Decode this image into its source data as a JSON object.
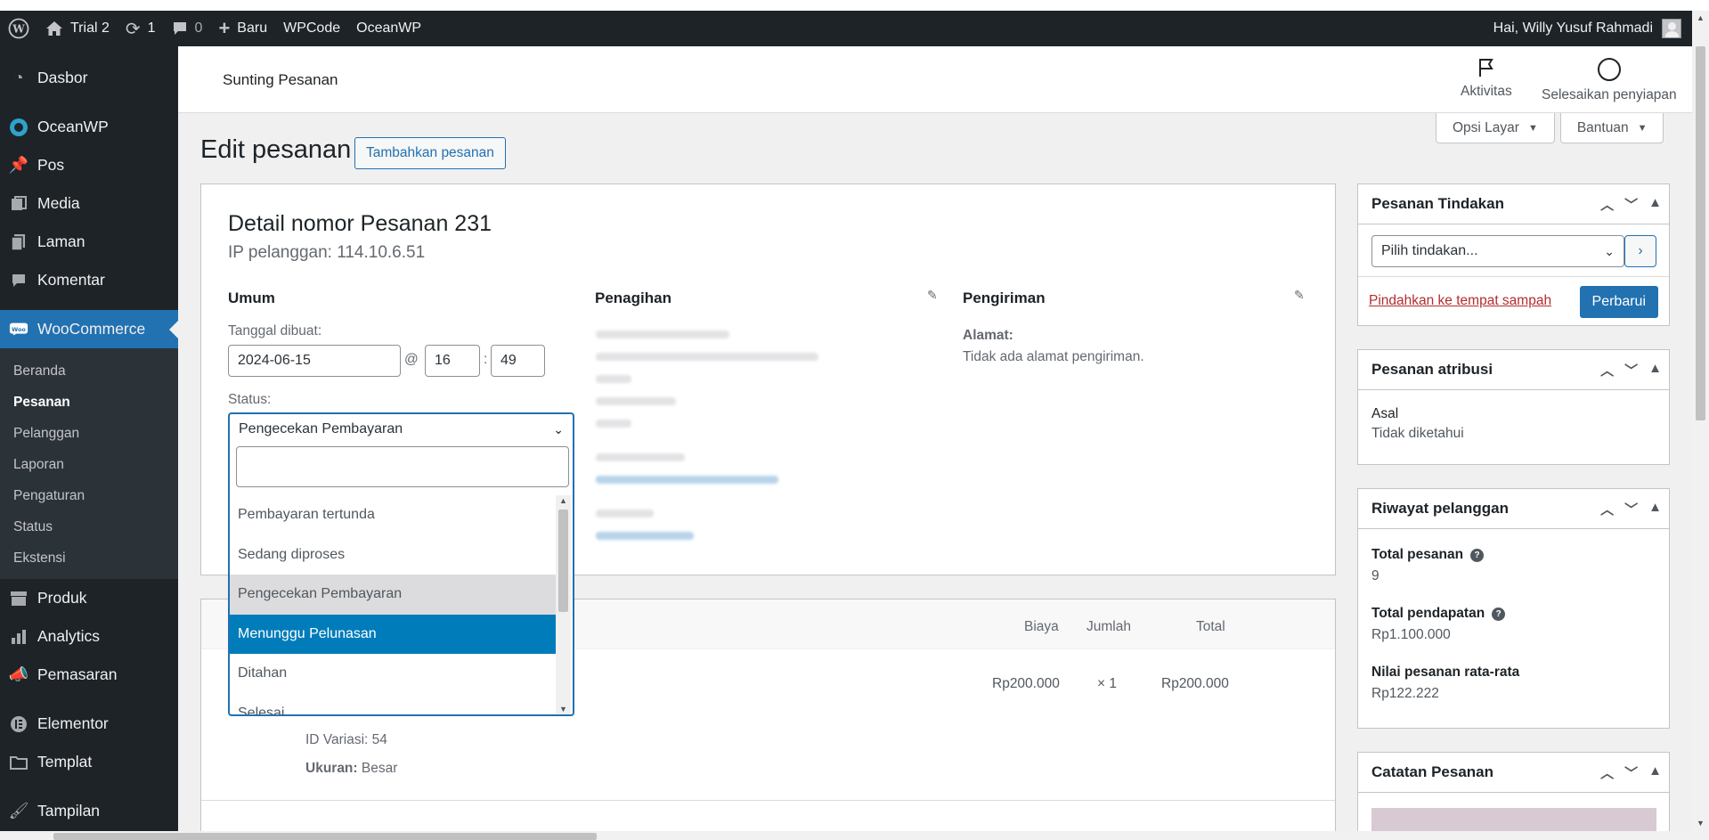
{
  "adminbar": {
    "site_name": "Trial 2",
    "updates_count": "1",
    "comments_count": "0",
    "new_label": "Baru",
    "wpcode_label": "WPCode",
    "oceanwp_label": "OceanWP",
    "greeting": "Hai, Willy Yusuf Rahmadi"
  },
  "sidebar": {
    "items_top": [
      {
        "label": "Dasbor",
        "icon": "dashboard-icon"
      },
      {
        "label": "OceanWP",
        "icon": "oceanwp-icon"
      },
      {
        "label": "Pos",
        "icon": "pin-icon"
      },
      {
        "label": "Media",
        "icon": "media-icon"
      },
      {
        "label": "Laman",
        "icon": "page-icon"
      },
      {
        "label": "Komentar",
        "icon": "comment-icon"
      }
    ],
    "woocommerce_label": "WooCommerce",
    "submenu": [
      "Beranda",
      "Pesanan",
      "Pelanggan",
      "Laporan",
      "Pengaturan",
      "Status",
      "Ekstensi"
    ],
    "items_bottom": [
      {
        "label": "Produk",
        "icon": "archive-icon"
      },
      {
        "label": "Analytics",
        "icon": "bar-chart-icon"
      },
      {
        "label": "Pemasaran",
        "icon": "megaphone-icon"
      },
      {
        "label": "Elementor",
        "icon": "elementor-icon"
      },
      {
        "label": "Templat",
        "icon": "folder-icon"
      },
      {
        "label": "Tampilan",
        "icon": "brush-icon"
      }
    ]
  },
  "header": {
    "title": "Sunting Pesanan",
    "activity_label": "Aktivitas",
    "setup_label": "Selesaikan penyiapan"
  },
  "screen_tabs": {
    "screen_options": "Opsi Layar",
    "help": "Bantuan"
  },
  "page": {
    "title": "Edit pesanan",
    "add_button": "Tambahkan pesanan"
  },
  "order": {
    "heading": "Detail nomor Pesanan 231",
    "ip": "IP pelanggan: 114.10.6.51",
    "general_heading": "Umum",
    "billing_heading": "Penagihan",
    "shipping_heading": "Pengiriman",
    "date_label": "Tanggal dibuat:",
    "date_value": "2024-06-15",
    "at": "@",
    "colon": ":",
    "hour": "16",
    "minute": "49",
    "status_label": "Status:",
    "status_value": "Pengecekan Pembayaran",
    "shipping_address_label": "Alamat:",
    "shipping_address_text": "Tidak ada alamat pengiriman."
  },
  "status_dropdown": {
    "options": [
      {
        "label": "Pembayaran tertunda",
        "state": "normal"
      },
      {
        "label": "Sedang diproses",
        "state": "normal"
      },
      {
        "label": "Pengecekan Pembayaran",
        "state": "hover"
      },
      {
        "label": "Menunggu Pelunasan",
        "state": "selected"
      },
      {
        "label": "Ditahan",
        "state": "normal"
      },
      {
        "label": "Selesai",
        "state": "normal"
      }
    ]
  },
  "items": {
    "col_cost": "Biaya",
    "col_qty": "Jumlah",
    "col_total": "Total",
    "row": {
      "cost": "Rp200.000",
      "qty": "× 1",
      "total": "Rp200.000"
    },
    "variation_id": "ID Variasi: 54",
    "size_label": "Ukuran:",
    "size_value": "Besar"
  },
  "order_actions": {
    "title": "Pesanan Tindakan",
    "select_placeholder": "Pilih tindakan...",
    "trash_link": "Pindahkan ke tempat sampah",
    "update_button": "Perbarui"
  },
  "attribution": {
    "title": "Pesanan atribusi",
    "origin_label": "Asal",
    "origin_value": "Tidak diketahui"
  },
  "customer_history": {
    "title": "Riwayat pelanggan",
    "total_orders_label": "Total pesanan",
    "total_orders_value": "9",
    "total_revenue_label": "Total pendapatan",
    "total_revenue_value": "Rp1.100.000",
    "avg_order_label": "Nilai pesanan rata-rata",
    "avg_order_value": "Rp122.222"
  },
  "order_notes": {
    "title": "Catatan Pesanan"
  }
}
